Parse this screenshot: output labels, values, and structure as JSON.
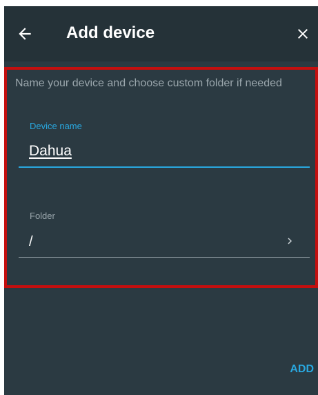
{
  "appbar": {
    "title": "Add device",
    "back_icon": "arrow-left-icon",
    "close_icon": "close-icon"
  },
  "form": {
    "hint": "Name your device and choose custom folder if needed",
    "device_name": {
      "label": "Device name",
      "value": "Dahua"
    },
    "folder": {
      "label": "Folder",
      "value": "/",
      "icon": "chevron-right-icon"
    }
  },
  "actions": {
    "add_label": "ADD"
  },
  "colors": {
    "background": "#2b3a42",
    "appbar": "#253238",
    "accent": "#29a8e0",
    "highlight_border": "#c40f0f"
  }
}
